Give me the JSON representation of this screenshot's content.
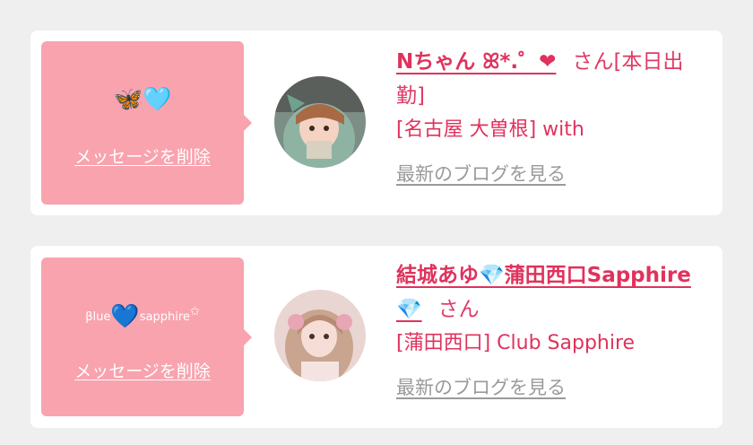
{
  "messages": [
    {
      "bubble_text": "🦋🩵",
      "delete_label": "メッセージを削除",
      "girl_name": "Nちゃん ꕤ*.゜❤",
      "honorific": "さん",
      "status": "[本日出勤]",
      "shop": "[名古屋 大曽根] with",
      "blog_label": "最新のブログを見る"
    },
    {
      "bubble_text_a": "βlue",
      "bubble_heart": "💙",
      "bubble_text_b": "sapphire",
      "bubble_star": "✩",
      "delete_label": "メッセージを削除",
      "girl_name": "結城あゆ💎蒲田西口Sapphire💎",
      "honorific": "さん",
      "shop": "[蒲田西口] Club Sapphire",
      "blog_label": "最新のブログを見る"
    }
  ],
  "colors": {
    "bubble": "#f8a3ae",
    "accent": "#e0325c",
    "link_gray": "#9a9a9a",
    "card_bg": "#ffffff",
    "page_bg": "#efefef"
  }
}
